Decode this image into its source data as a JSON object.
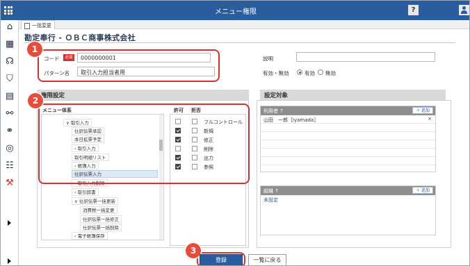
{
  "topbar": {
    "title": "メニュー権限",
    "help_label": "?"
  },
  "sidebar": {
    "icons": [
      "home-icon",
      "building-icon",
      "users-icon",
      "shield-icon",
      "id-card-icon",
      "share-icon",
      "binoculars-icon",
      "network-icon",
      "certificate-icon",
      "hammer-icon"
    ]
  },
  "tabs": [
    {
      "label": "一括変更"
    }
  ],
  "company": "勘定奉行 - ＯＢＣ商事株式会社",
  "form": {
    "code_label": "コード",
    "required_badge": "必須",
    "code_value": "0000000001",
    "pattern_label": "パターン名",
    "pattern_value": "取引入力担当者用",
    "desc_label": "説明",
    "desc_value": "",
    "status_label": "有効・無効",
    "status_options": [
      "有効",
      "無効"
    ],
    "status_selected": "有効"
  },
  "perm": {
    "section_title": "権限設定",
    "menu_header": "メニュー体系",
    "allow_header": "許可",
    "deny_header": "拒否",
    "tree": [
      "取引入力",
      "仕訳伝票承認",
      "本日拡票予定",
      "取引入力",
      "取引明細リスト",
      "帳簿入力",
      "仕訳伝票入力",
      "取引入力削除",
      "取引辞書",
      "仕訳伝票一括更新",
      "消費税一括変更",
      "仕訳伝票一括修正",
      "仕訳伝票一括削除",
      "電子帳簿保存"
    ],
    "selected_index": 6,
    "permissions": [
      {
        "label": "フルコントロール",
        "allow": false,
        "deny": false
      },
      {
        "label": "新規",
        "allow": true,
        "deny": false
      },
      {
        "label": "修正",
        "allow": true,
        "deny": false
      },
      {
        "label": "削除",
        "allow": false,
        "deny": false
      },
      {
        "label": "出力",
        "allow": true,
        "deny": false
      },
      {
        "label": "参照",
        "allow": true,
        "deny": false
      }
    ]
  },
  "target": {
    "section_title": "設定対象",
    "users_header": "利用者 ↑",
    "add_label": "＋ 追加",
    "users": [
      {
        "name": "山田　一郎［iyamada］",
        "remove": "×"
      }
    ],
    "org_header": "組織 ↑",
    "org_value": "未設定"
  },
  "annotations": [
    "1",
    "2",
    "3"
  ],
  "footer": {
    "register": "登録",
    "back": "一覧に戻る"
  }
}
